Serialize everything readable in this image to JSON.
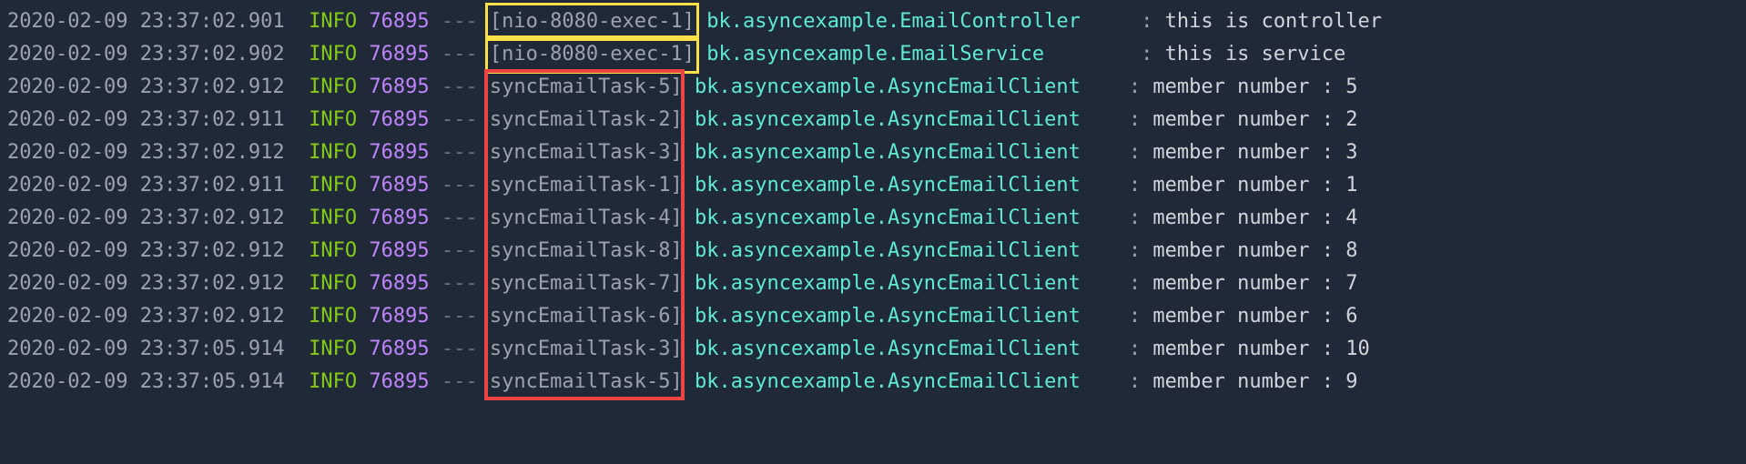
{
  "logs": [
    {
      "timestamp": "2020-02-09 23:37:02.901",
      "level": "INFO",
      "pid": "76895",
      "sep": "---",
      "thread": "[nio-8080-exec-1]",
      "logger": "bk.asyncexample.EmailController",
      "message": "this is controller",
      "highlight": "yellow"
    },
    {
      "timestamp": "2020-02-09 23:37:02.902",
      "level": "INFO",
      "pid": "76895",
      "sep": "---",
      "thread": "[nio-8080-exec-1]",
      "logger": "bk.asyncexample.EmailService",
      "message": "this is service",
      "highlight": "yellow"
    },
    {
      "timestamp": "2020-02-09 23:37:02.912",
      "level": "INFO",
      "pid": "76895",
      "sep": "---",
      "thread": "syncEmailTask-5]",
      "logger": "bk.asyncexample.AsyncEmailClient",
      "message": "member number : 5",
      "highlight": "red"
    },
    {
      "timestamp": "2020-02-09 23:37:02.911",
      "level": "INFO",
      "pid": "76895",
      "sep": "---",
      "thread": "syncEmailTask-2]",
      "logger": "bk.asyncexample.AsyncEmailClient",
      "message": "member number : 2",
      "highlight": "red"
    },
    {
      "timestamp": "2020-02-09 23:37:02.912",
      "level": "INFO",
      "pid": "76895",
      "sep": "---",
      "thread": "syncEmailTask-3]",
      "logger": "bk.asyncexample.AsyncEmailClient",
      "message": "member number : 3",
      "highlight": "red"
    },
    {
      "timestamp": "2020-02-09 23:37:02.911",
      "level": "INFO",
      "pid": "76895",
      "sep": "---",
      "thread": "syncEmailTask-1]",
      "logger": "bk.asyncexample.AsyncEmailClient",
      "message": "member number : 1",
      "highlight": "red"
    },
    {
      "timestamp": "2020-02-09 23:37:02.912",
      "level": "INFO",
      "pid": "76895",
      "sep": "---",
      "thread": "syncEmailTask-4]",
      "logger": "bk.asyncexample.AsyncEmailClient",
      "message": "member number : 4",
      "highlight": "red"
    },
    {
      "timestamp": "2020-02-09 23:37:02.912",
      "level": "INFO",
      "pid": "76895",
      "sep": "---",
      "thread": "syncEmailTask-8]",
      "logger": "bk.asyncexample.AsyncEmailClient",
      "message": "member number : 8",
      "highlight": "red"
    },
    {
      "timestamp": "2020-02-09 23:37:02.912",
      "level": "INFO",
      "pid": "76895",
      "sep": "---",
      "thread": "syncEmailTask-7]",
      "logger": "bk.asyncexample.AsyncEmailClient",
      "message": "member number : 7",
      "highlight": "red"
    },
    {
      "timestamp": "2020-02-09 23:37:02.912",
      "level": "INFO",
      "pid": "76895",
      "sep": "---",
      "thread": "syncEmailTask-6]",
      "logger": "bk.asyncexample.AsyncEmailClient",
      "message": "member number : 6",
      "highlight": "red"
    },
    {
      "timestamp": "2020-02-09 23:37:05.914",
      "level": "INFO",
      "pid": "76895",
      "sep": "---",
      "thread": "syncEmailTask-3]",
      "logger": "bk.asyncexample.AsyncEmailClient",
      "message": "member number : 10",
      "highlight": "red"
    },
    {
      "timestamp": "2020-02-09 23:37:05.914",
      "level": "INFO",
      "pid": "76895",
      "sep": "---",
      "thread": "syncEmailTask-5]",
      "logger": "bk.asyncexample.AsyncEmailClient",
      "message": "member number : 9",
      "highlight": "red"
    }
  ],
  "layout": {
    "logger_col_width_ch": 36,
    "colon": ":"
  }
}
